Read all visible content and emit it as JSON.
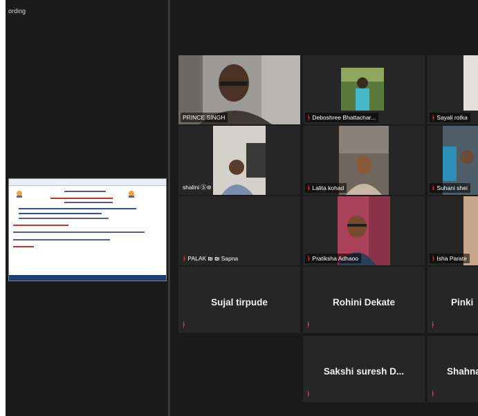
{
  "left": {
    "recording_label": "ording"
  },
  "participants": {
    "prince": "PRINCE SINGH",
    "deboshree": "Deboshree Bhattachar...",
    "sayali": "Sayali rotka",
    "shalini": "shalini",
    "lalita": "Lalita kohad",
    "suhani": "Suhani shei",
    "palak": "PALAK",
    "palak_rest": "Sapna",
    "pratiksha": "Pratiksha Adhaoo",
    "isha": "Isha Parate",
    "sujal": "Sujal tirpude",
    "rohini": "Rohini Dekate",
    "pinki": "Pinki",
    "sakshi": "Sakshi suresh D...",
    "shahna": "Shahna"
  },
  "icons": {
    "muted_mic": "muted-mic-icon"
  },
  "colors": {
    "active_speaker_border": "#d6e05a",
    "muted_mic": "#e0433b"
  }
}
